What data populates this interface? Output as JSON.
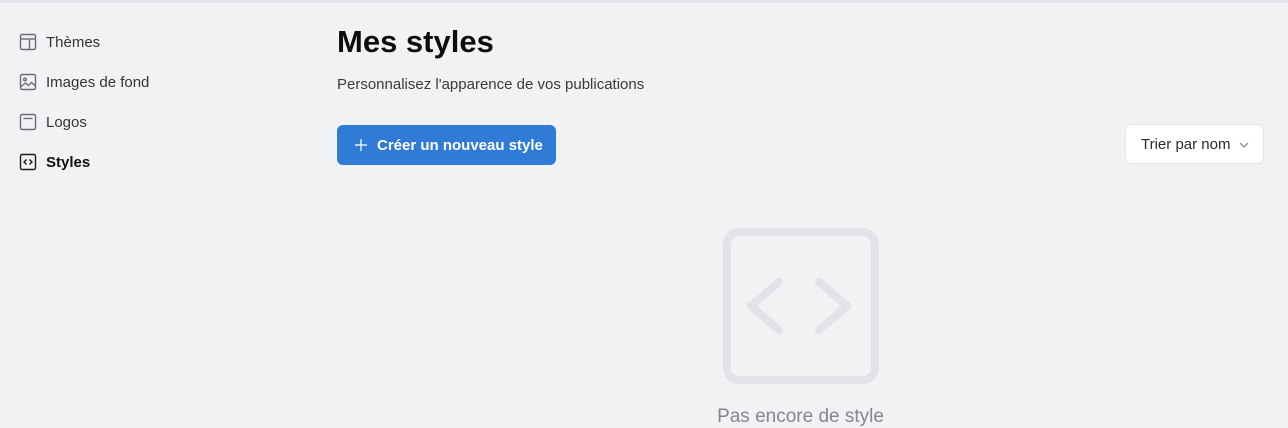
{
  "sidebar": {
    "items": [
      {
        "label": "Thèmes",
        "icon": "layout-icon",
        "active": false
      },
      {
        "label": "Images de fond",
        "icon": "image-icon",
        "active": false
      },
      {
        "label": "Logos",
        "icon": "logo-frame-icon",
        "active": false
      },
      {
        "label": "Styles",
        "icon": "code-icon",
        "active": true
      }
    ]
  },
  "main": {
    "title": "Mes styles",
    "subtitle": "Personnalisez l'apparence de vos publications",
    "create_button": "Créer un nouveau style",
    "sort_select": "Trier par nom",
    "empty_state": "Pas encore de style"
  },
  "colors": {
    "accent": "#2f7bd6",
    "background": "#f1f2f4"
  }
}
